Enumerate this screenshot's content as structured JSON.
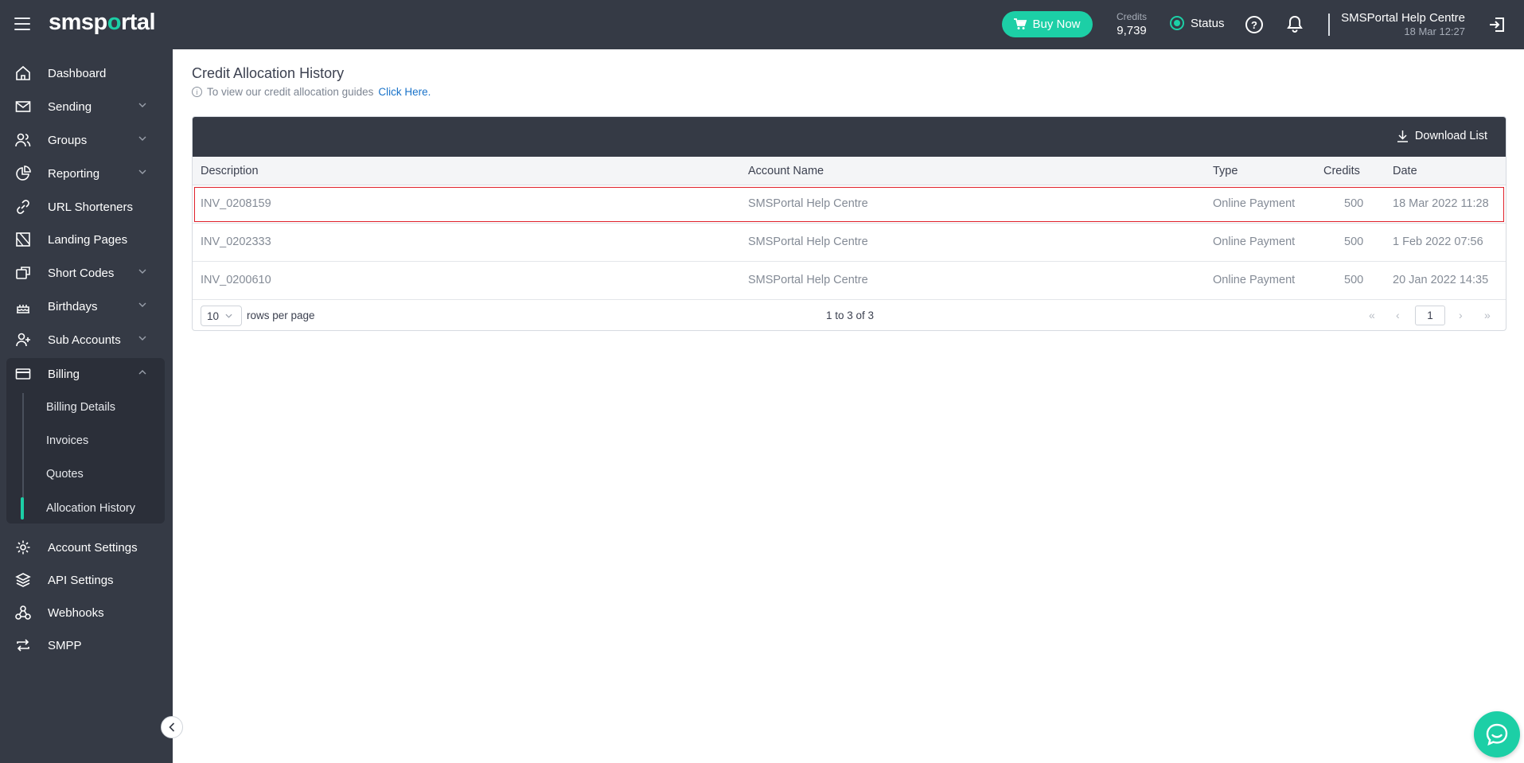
{
  "topbar": {
    "logo_pre": "sms",
    "logo_o": "o",
    "logo_post": "rtal",
    "logo_p": "p",
    "buy_label": "Buy Now",
    "credits_label": "Credits",
    "credits_value": "9,739",
    "status_label": "Status",
    "user_name": "SMSPortal Help Centre",
    "user_date": "18 Mar 12:27"
  },
  "sidebar": {
    "items": [
      {
        "label": "Dashboard"
      },
      {
        "label": "Sending"
      },
      {
        "label": "Groups"
      },
      {
        "label": "Reporting"
      },
      {
        "label": "URL Shorteners"
      },
      {
        "label": "Landing Pages"
      },
      {
        "label": "Short Codes"
      },
      {
        "label": "Birthdays"
      },
      {
        "label": "Sub Accounts"
      },
      {
        "label": "Billing"
      },
      {
        "label": "Account Settings"
      },
      {
        "label": "API Settings"
      },
      {
        "label": "Webhooks"
      },
      {
        "label": "SMPP"
      }
    ],
    "billing_sub": [
      {
        "label": "Billing Details"
      },
      {
        "label": "Invoices"
      },
      {
        "label": "Quotes"
      },
      {
        "label": "Allocation History"
      }
    ]
  },
  "main": {
    "title": "Credit Allocation History",
    "info_text": "To view our credit allocation guides",
    "info_link": "Click Here.",
    "download_label": "Download List",
    "columns": {
      "description": "Description",
      "account": "Account Name",
      "type": "Type",
      "credits": "Credits",
      "date": "Date"
    },
    "rows": [
      {
        "description": "INV_0208159",
        "account": "SMSPortal Help Centre",
        "type": "Online Payment",
        "credits": "500",
        "date": "18 Mar 2022 11:28"
      },
      {
        "description": "INV_0202333",
        "account": "SMSPortal Help Centre",
        "type": "Online Payment",
        "credits": "500",
        "date": "1 Feb 2022 07:56"
      },
      {
        "description": "INV_0200610",
        "account": "SMSPortal Help Centre",
        "type": "Online Payment",
        "credits": "500",
        "date": "20 Jan 2022 14:35"
      }
    ],
    "pager": {
      "rows_per_page_value": "10",
      "rows_per_page_label": "rows per page",
      "range": "1 to 3 of 3",
      "page": "1"
    }
  },
  "colors": {
    "sidebar_bg": "#353a45",
    "accent": "#1ccfa6",
    "link": "#1a73c9",
    "highlight_border": "#e0202a"
  }
}
